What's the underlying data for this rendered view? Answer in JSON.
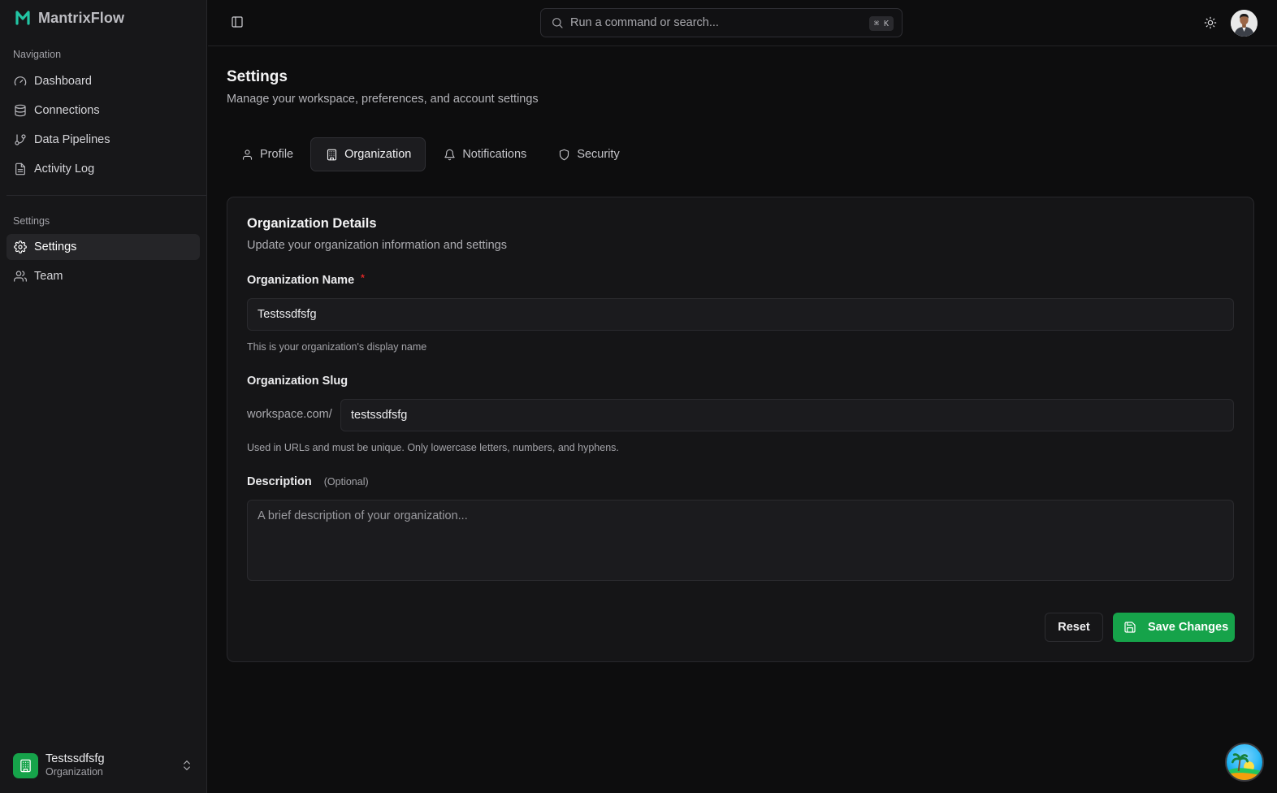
{
  "app": {
    "name": "MantrixFlow",
    "logo_icon": "mantrixflow-logo-icon",
    "accent_color": "#16a34a",
    "logo_color": "#22c5a4"
  },
  "sidebar": {
    "navigation_label": "Navigation",
    "nav_items": [
      {
        "label": "Dashboard",
        "icon": "gauge-icon"
      },
      {
        "label": "Connections",
        "icon": "database-icon"
      },
      {
        "label": "Data Pipelines",
        "icon": "git-branch-icon"
      },
      {
        "label": "Activity Log",
        "icon": "file-text-icon"
      }
    ],
    "settings_label": "Settings",
    "settings_items": [
      {
        "label": "Settings",
        "icon": "gear-icon",
        "active": true
      },
      {
        "label": "Team",
        "icon": "users-icon"
      }
    ],
    "org_switcher": {
      "name": "Testssdfsfg",
      "type": "Organization",
      "icon": "building-icon"
    }
  },
  "topbar": {
    "search_placeholder": "Run a command or search...",
    "search_shortcut": "⌘ K",
    "theme_icon": "sun-icon"
  },
  "page": {
    "title": "Settings",
    "subtitle": "Manage your workspace, preferences, and account settings"
  },
  "tabs": [
    {
      "label": "Profile",
      "icon": "user-icon"
    },
    {
      "label": "Organization",
      "icon": "building-icon",
      "active": true
    },
    {
      "label": "Notifications",
      "icon": "bell-icon"
    },
    {
      "label": "Security",
      "icon": "shield-icon"
    }
  ],
  "card": {
    "title": "Organization Details",
    "subtitle": "Update your organization information and settings",
    "org_name": {
      "label": "Organization Name",
      "required_mark": "*",
      "value": "Testssdfsfg",
      "hint": "This is your organization's display name"
    },
    "org_slug": {
      "label": "Organization Slug",
      "prefix": "workspace.com/",
      "value": "testssdfsfg",
      "hint": "Used in URLs and must be unique. Only lowercase letters, numbers, and hyphens."
    },
    "description": {
      "label": "Description",
      "optional_text": "(Optional)",
      "value": "",
      "placeholder": "A brief description of your organization..."
    },
    "reset_label": "Reset",
    "save_label": "Save Changes"
  }
}
